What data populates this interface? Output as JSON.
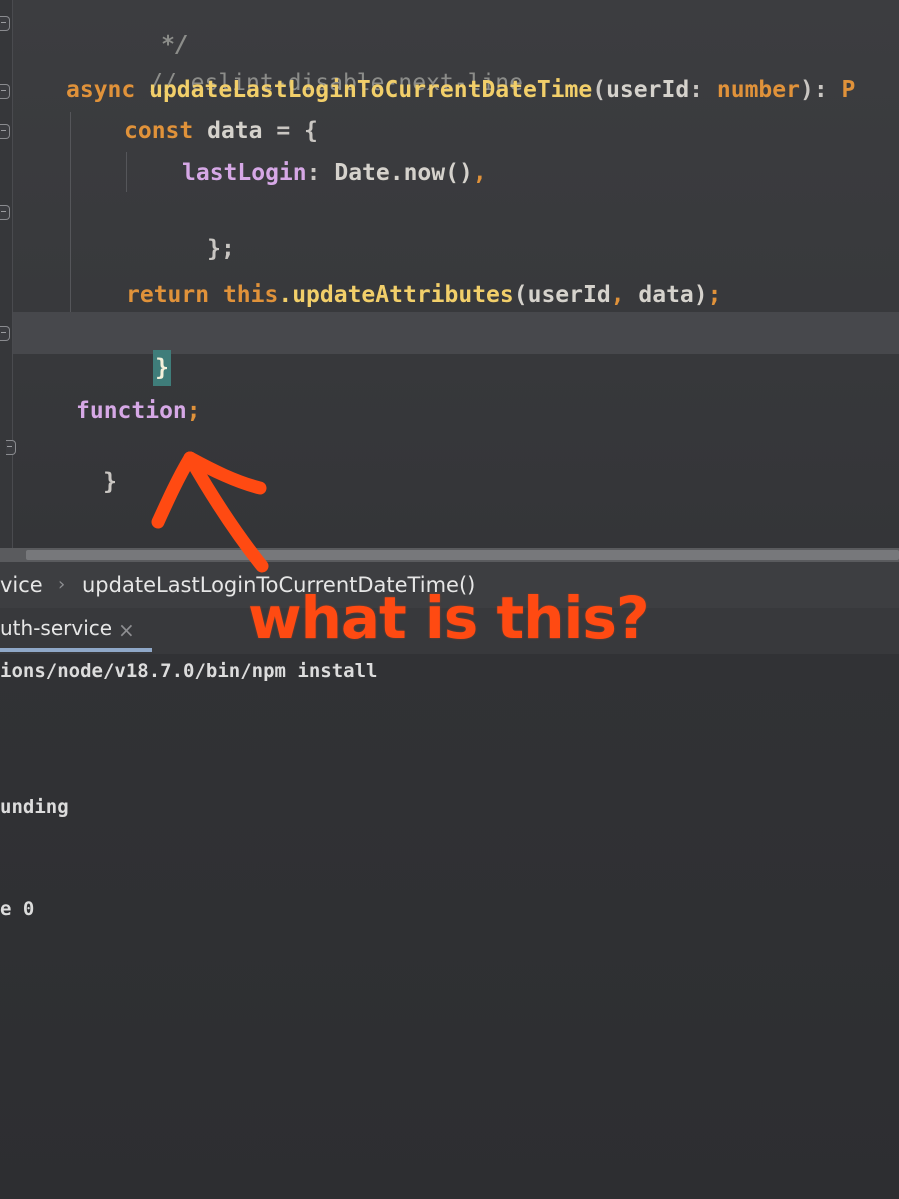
{
  "editor": {
    "comment_close": "*/",
    "eslint_comment": "// eslint-disable-next-line",
    "method_signature": {
      "keyword": "async",
      "name": "updateLastLoginToCurrentDateTime",
      "open_paren": "(",
      "param": "userId",
      "colon": ":",
      "type": "number",
      "close": "):",
      "cut_off": "P"
    },
    "const_line": {
      "keyword": "const",
      "name": "data",
      "rest": "= {"
    },
    "property_line": {
      "prop": "lastLogin",
      "colon": ":",
      "value": "Date.now()",
      "comma": ","
    },
    "close_object": "};",
    "return_line": {
      "keyword": "return",
      "this": "this",
      "call": ".updateAttributes",
      "args_open": "(userId",
      "comma": ",",
      "args_close": " data)",
      "semicolon": ";"
    },
    "method_close": "}",
    "stray_line": {
      "text": "function",
      "semicolon": ";"
    },
    "class_close": "}"
  },
  "breadcrumb": {
    "parent": "vice",
    "separator": "›",
    "current": "updateLastLoginToCurrentDateTime()"
  },
  "terminal_tab": {
    "label": "uth-service",
    "close": "×"
  },
  "terminal": {
    "lines": [
      "ions/node/v18.7.0/bin/npm install",
      "unding",
      "e 0"
    ]
  },
  "annotation": {
    "text": "what is this?",
    "color": "#ff4a12"
  }
}
